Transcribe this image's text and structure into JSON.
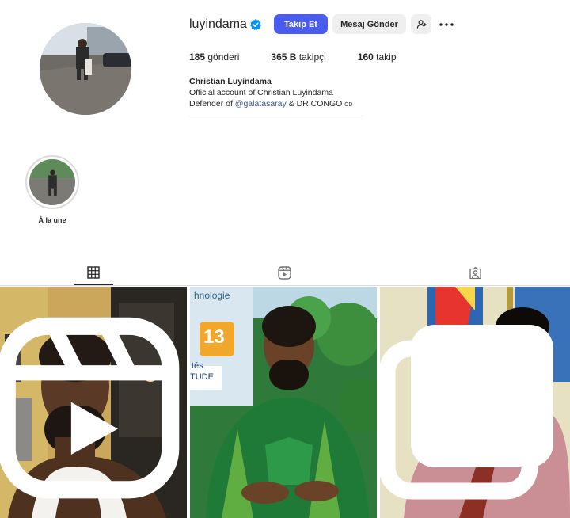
{
  "profile": {
    "username": "luyindama",
    "follow_label": "Takip Et",
    "message_label": "Mesaj Gönder",
    "brand_color": "#4a5cf0"
  },
  "stats": {
    "posts_count": "185",
    "posts_label": "gönderi",
    "followers_count": "365 B",
    "followers_label": "takipçi",
    "following_count": "160",
    "following_label": "takip"
  },
  "bio": {
    "name": "Christian Luyindama",
    "line1": "Official account of Christian Luyindama",
    "line2_prefix": "Defender of ",
    "line2_link": "@galatasaray",
    "line2_suffix": " & DR CONGO ",
    "line2_flag": "CD"
  },
  "highlights": [
    {
      "label": "À la une"
    }
  ],
  "tabs": [
    {
      "icon": "grid-icon",
      "active": true
    },
    {
      "icon": "reels-icon",
      "active": false
    },
    {
      "icon": "tagged-icon",
      "active": false
    }
  ],
  "posts": [
    {
      "icon": "reel-badge-icon"
    },
    {
      "sign_text_1": "hnologie",
      "sign_text_2": "13",
      "sign_text_3": "tés.",
      "sign_text_4": "TUDE"
    },
    {
      "icon": "reel-badge-icon"
    }
  ]
}
